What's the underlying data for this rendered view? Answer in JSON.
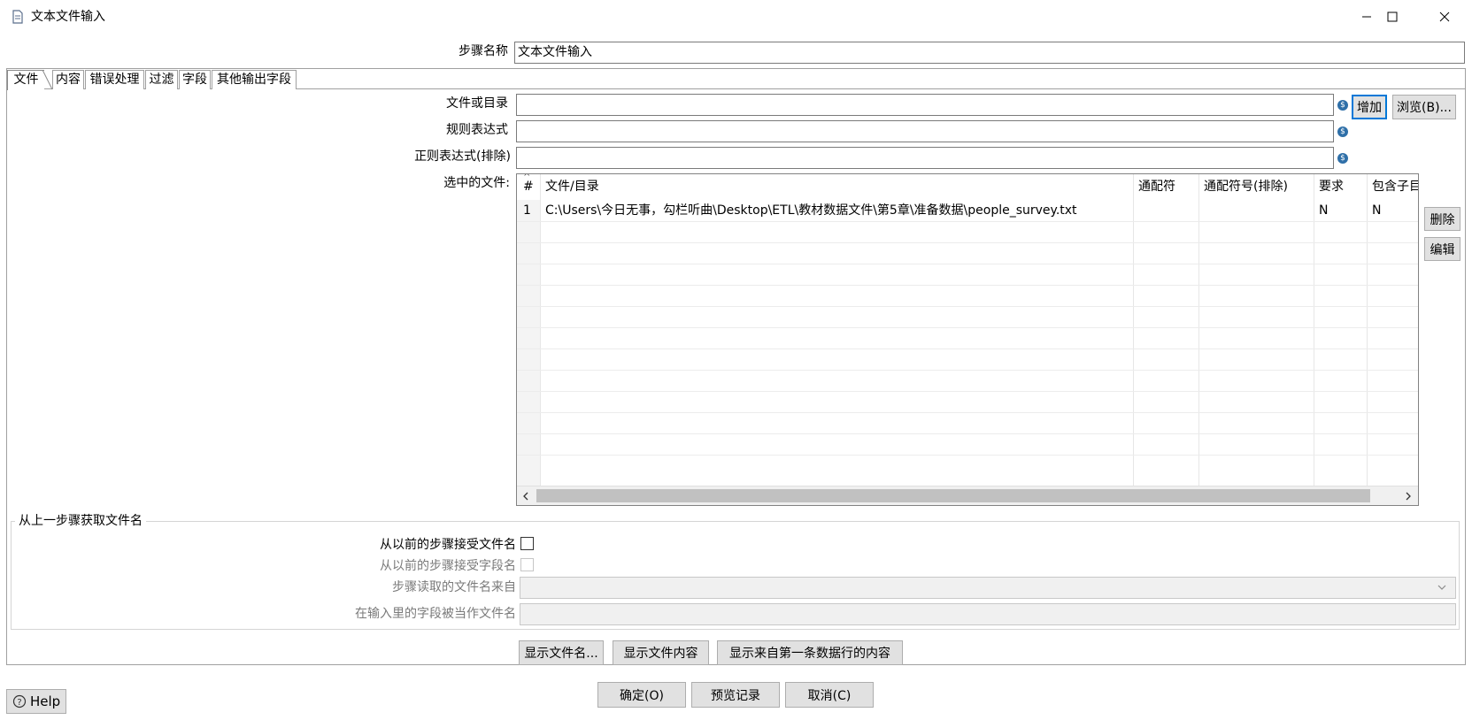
{
  "window": {
    "title": "文本文件输入",
    "controls": [
      "minimize-icon",
      "maximize-icon",
      "close-icon"
    ]
  },
  "step_name": {
    "label": "步骤名称",
    "value": "文本文件输入"
  },
  "tabs": [
    {
      "label": "文件",
      "active": true
    },
    {
      "label": "内容"
    },
    {
      "label": "错误处理"
    },
    {
      "label": "过滤"
    },
    {
      "label": "字段"
    },
    {
      "label": "其他输出字段"
    }
  ],
  "file_tab": {
    "file_or_dir": {
      "label": "文件或目录",
      "value": ""
    },
    "regex": {
      "label": "规则表达式",
      "value": ""
    },
    "regex_exclude": {
      "label": "正则表达式(排除)",
      "value": ""
    },
    "add_button": "增加",
    "browse_button": "浏览(B)...",
    "selected_files_label": "选中的文件:",
    "delete_button": "删除",
    "edit_button": "编辑",
    "table": {
      "sort_indicator": "^",
      "columns": [
        "#",
        "文件/目录",
        "通配符",
        "通配符号(排除)",
        "要求",
        "包含子目"
      ],
      "rows": [
        [
          "1",
          "C:\\Users\\今日无事，勾栏听曲\\Desktop\\ETL\\教材数据文件\\第5章\\准备数据\\people_survey.txt",
          "",
          "",
          "N",
          "N"
        ]
      ]
    },
    "prev_step_group": {
      "title": "从上一步骤获取文件名",
      "accept_filenames": {
        "label": "从以前的步骤接受文件名",
        "checked": false
      },
      "accept_fieldnames": {
        "label": "从以前的步骤接受字段名",
        "checked": false,
        "enabled": false
      },
      "step_to_read": {
        "label": "步骤读取的文件名来自",
        "value": ""
      },
      "field_in_input": {
        "label": "在输入里的字段被当作文件名",
        "value": ""
      }
    },
    "show_filenames_button": "显示文件名...",
    "show_content_button": "显示文件内容",
    "show_first_row_button": "显示来自第一条数据行的内容"
  },
  "footer": {
    "help_button": "Help",
    "ok_button": "确定(O)",
    "preview_button": "预览记录",
    "cancel_button": "取消(C)"
  },
  "colors": {
    "accent": "#0078d7",
    "variable_icon": "#2e6fa8",
    "button_bg": "#e1e1e1"
  }
}
